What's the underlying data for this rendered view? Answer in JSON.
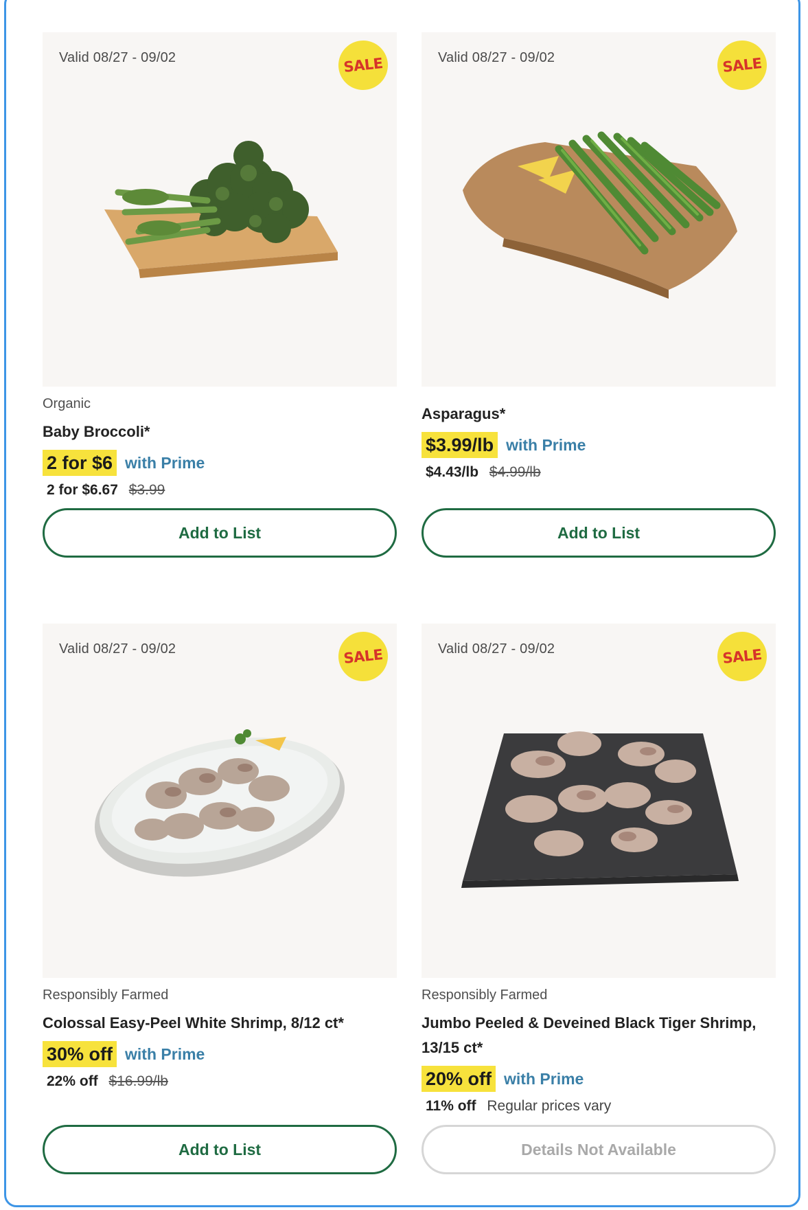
{
  "cards": [
    {
      "valid": "Valid 08/27 - 09/02",
      "badge": "SALE",
      "image_icon": "baby-broccoli-image",
      "category": "Organic",
      "name": "Baby Broccoli*",
      "promo": "2 for $6",
      "prime": "with Prime",
      "regular_now": "2 for $6.67",
      "regular_was": "$3.99",
      "regular_note": "",
      "button": "Add to List",
      "button_enabled": true
    },
    {
      "valid": "Valid 08/27 - 09/02",
      "badge": "SALE",
      "image_icon": "asparagus-image",
      "category": "",
      "name": "Asparagus*",
      "promo": "$3.99/lb",
      "prime": "with Prime",
      "regular_now": "$4.43/lb",
      "regular_was": "$4.99/lb",
      "regular_note": "",
      "button": "Add to List",
      "button_enabled": true
    },
    {
      "valid": "Valid 08/27 - 09/02",
      "badge": "SALE",
      "image_icon": "white-shrimp-image",
      "category": "Responsibly Farmed",
      "name": "Colossal Easy-Peel White Shrimp, 8/12 ct*",
      "promo": "30% off",
      "prime": "with Prime",
      "regular_now": "22% off",
      "regular_was": "$16.99/lb",
      "regular_note": "",
      "button": "Add to List",
      "button_enabled": true
    },
    {
      "valid": "Valid 08/27 - 09/02",
      "badge": "SALE",
      "image_icon": "black-tiger-shrimp-image",
      "category": "Responsibly Farmed",
      "name": "Jumbo Peeled & Deveined Black Tiger Shrimp, 13/15 ct*",
      "promo": "20% off",
      "prime": "with Prime",
      "regular_now": "11% off",
      "regular_was": "",
      "regular_note": "Regular prices vary",
      "button": "Details Not Available",
      "button_enabled": false
    }
  ],
  "colors": {
    "promo_highlight": "#f7e23c",
    "prime_text": "#3a7fa7",
    "button_green": "#1f6b42",
    "sale_red": "#d6342a",
    "frame_blue": "#3d95e6"
  }
}
